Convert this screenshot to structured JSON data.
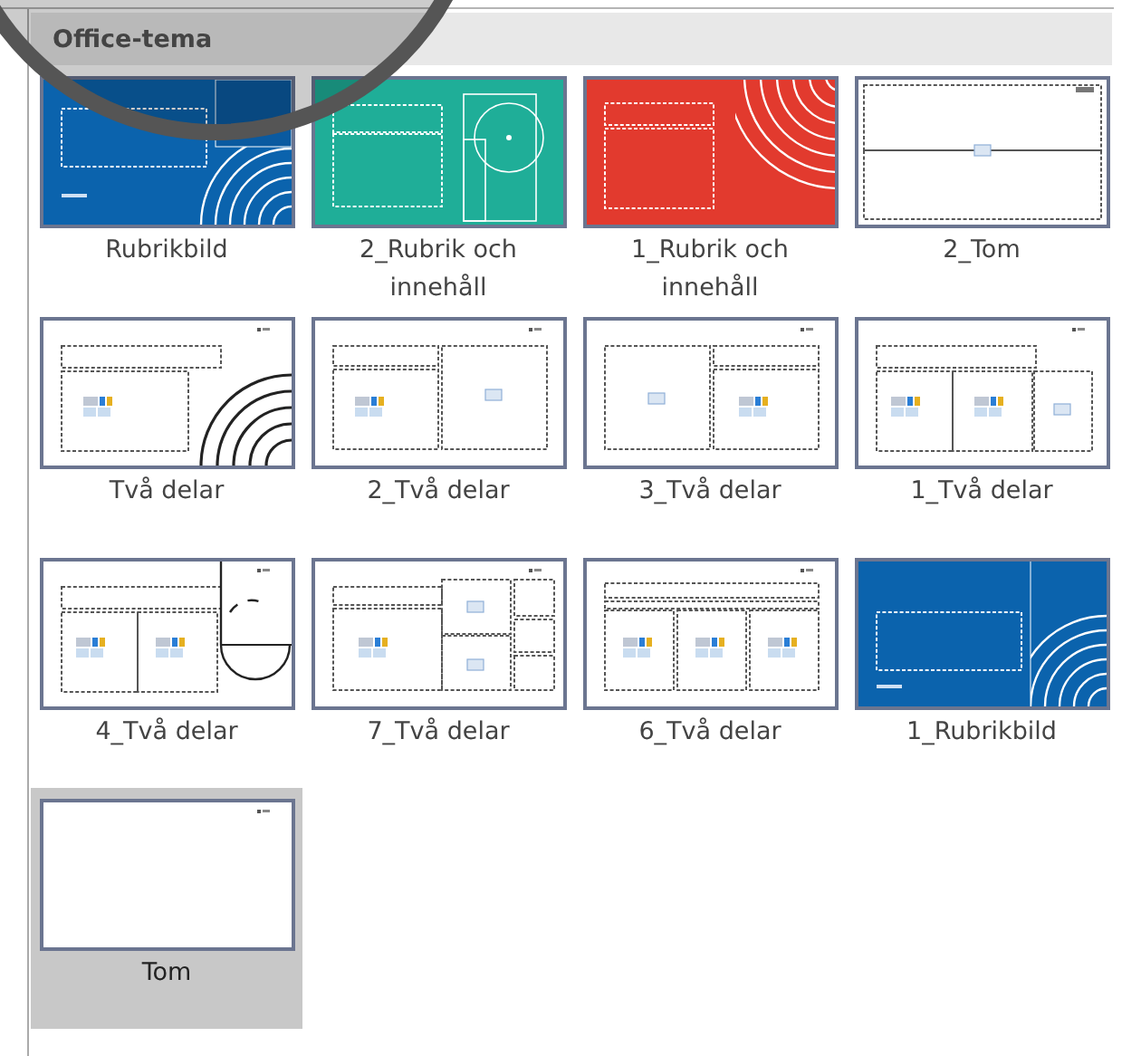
{
  "gallery": {
    "title": "Office-tema",
    "layouts": [
      {
        "label": "Rubrikbild",
        "kind": "title-blue",
        "selected": false
      },
      {
        "label": "2_Rubrik och innehåll",
        "kind": "content-teal",
        "selected": false
      },
      {
        "label": "1_Rubrik och innehåll",
        "kind": "content-red",
        "selected": false
      },
      {
        "label": "2_Tom",
        "kind": "sections",
        "selected": false
      },
      {
        "label": "Två delar",
        "kind": "two-arcs",
        "selected": false
      },
      {
        "label": "2_Två delar",
        "kind": "two-picture",
        "selected": false
      },
      {
        "label": "3_Två delar",
        "kind": "picture-two",
        "selected": false
      },
      {
        "label": "1_Två delar",
        "kind": "three-columns",
        "selected": false
      },
      {
        "label": "4_Två delar",
        "kind": "two-semicircle",
        "selected": false
      },
      {
        "label": "7_Två delar",
        "kind": "grid-seven",
        "selected": false
      },
      {
        "label": "6_Två delar",
        "kind": "six-columns",
        "selected": false
      },
      {
        "label": "1_Rubrikbild",
        "kind": "title-blue-alt",
        "selected": false
      },
      {
        "label": "Tom",
        "kind": "blank",
        "selected": true
      }
    ]
  }
}
